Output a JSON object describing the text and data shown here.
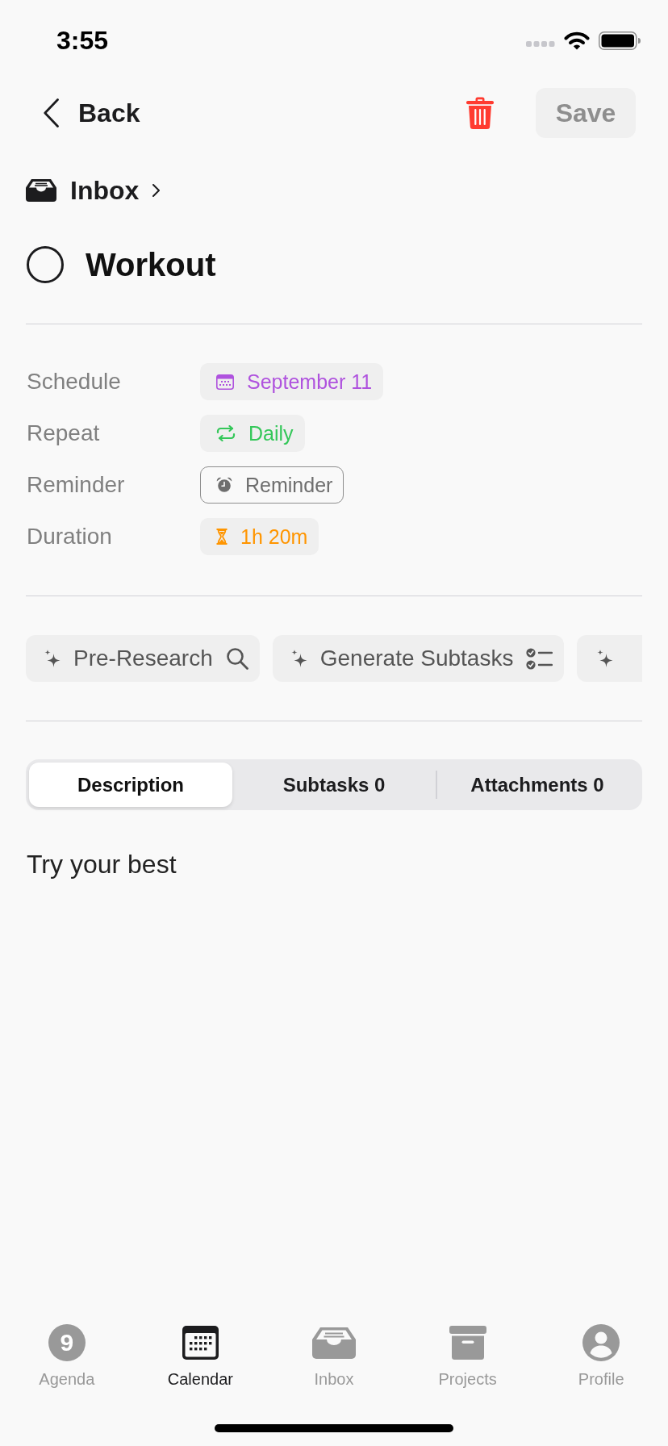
{
  "status_bar": {
    "time": "3:55"
  },
  "header": {
    "back": {
      "label": "Back"
    },
    "save": {
      "label": "Save",
      "disabled": true
    }
  },
  "breadcrumb": {
    "label": "Inbox"
  },
  "task": {
    "title": "Workout",
    "completed": false
  },
  "properties": [
    {
      "label": "Schedule",
      "kind": "date",
      "value": "September 11",
      "set": true,
      "color": "#af52de"
    },
    {
      "label": "Repeat",
      "kind": "repeat",
      "value": "Daily",
      "set": true,
      "color": "#34c759"
    },
    {
      "label": "Reminder",
      "kind": "reminder",
      "value": "Reminder",
      "set": false,
      "color": "#6e6e6e"
    },
    {
      "label": "Duration",
      "kind": "duration",
      "value": "1h 20m",
      "set": true,
      "color": "#ff9500"
    }
  ],
  "ai_actions": [
    {
      "label": "Pre-Research",
      "kind": "research"
    },
    {
      "label": "Generate Subtasks",
      "kind": "subtasks"
    },
    {
      "kind": "partial"
    }
  ],
  "tabs": [
    {
      "label": "Description",
      "selected": true
    },
    {
      "label": "Subtasks 0",
      "selected": false
    },
    {
      "label": "Attachments 0",
      "selected": false
    }
  ],
  "description": "Try your best",
  "tab_bar": [
    {
      "label": "Agenda",
      "kind": "agenda",
      "day": "9",
      "selected": false
    },
    {
      "label": "Calendar",
      "kind": "calendar",
      "selected": true
    },
    {
      "label": "Inbox",
      "kind": "inbox",
      "selected": false
    },
    {
      "label": "Projects",
      "kind": "projects",
      "selected": false
    },
    {
      "label": "Profile",
      "kind": "profile",
      "selected": false
    }
  ]
}
